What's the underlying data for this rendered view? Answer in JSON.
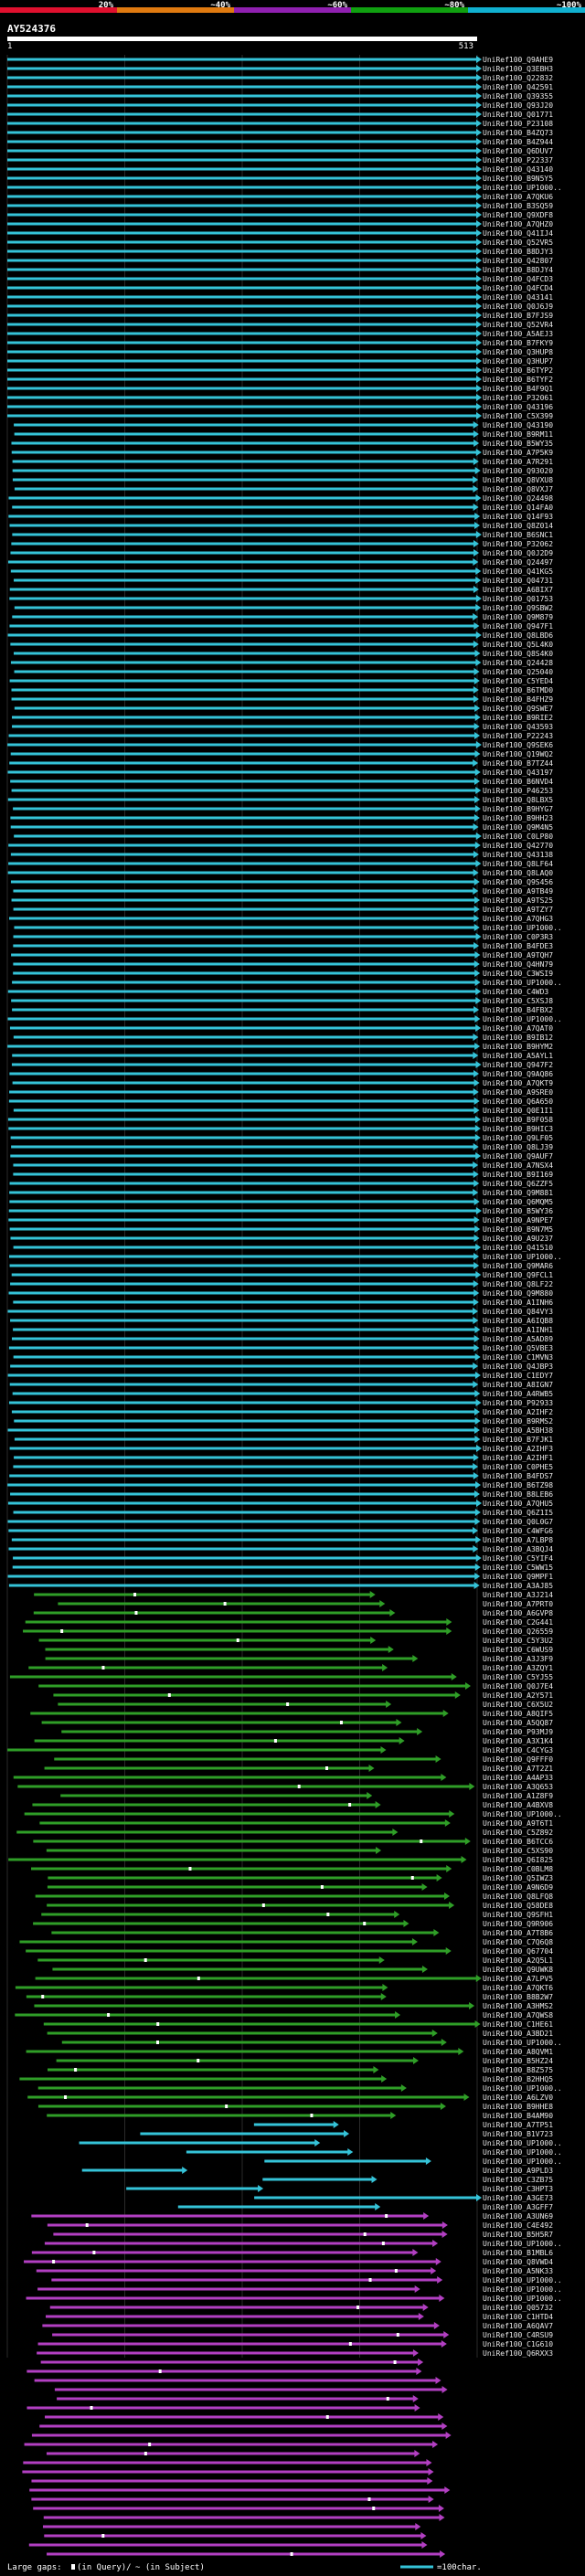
{
  "chart_data": {
    "type": "alignment-overview",
    "title": "AY524376",
    "scale": {
      "ticks": [
        "20%",
        "~40%",
        "~60%",
        "~80%",
        "~100%"
      ],
      "colors": [
        "#e0102e",
        "#e07a10",
        "#9020b0",
        "#10a010",
        "#10b0d0"
      ]
    },
    "query": {
      "start": "1",
      "end": "513"
    },
    "colors": {
      "cyan": "#35c3d8",
      "green": "#2f9e27",
      "magenta": "#b23fc2",
      "gap": "#ffffff",
      "grid": "#2a2a2a",
      "label": "#e8e8e8"
    },
    "legend": {
      "large_gaps": "Large gaps:",
      "in_query": "(in Query)/",
      "in_subject": "~ (in Subject)",
      "scale_note": "=100char."
    },
    "labels": [
      "UniRef100_Q9AHE9",
      "UniRef100_Q3EBH3",
      "UniRef100_Q22832",
      "UniRef100_Q42591",
      "UniRef100_Q39355",
      "UniRef100_Q93J20",
      "UniRef100_Q01771",
      "UniRef100_P23108",
      "UniRef100_B4ZQ73",
      "UniRef100_B4Z944",
      "UniRef100_Q6DUV7",
      "UniRef100_P22337",
      "UniRef100_Q43140",
      "UniRef100_B9N5Y5",
      "UniRef100_UP1000..",
      "UniRef100_A7QKU6",
      "UniRef100_B3SQ59",
      "UniRef100_Q9XDF8",
      "UniRef100_A7QHZ0",
      "UniRef100_Q41IJ4",
      "UniRef100_Q52VR5",
      "UniRef100_B8DJY3",
      "UniRef100_Q42807",
      "UniRef100_B8DJY4",
      "UniRef100_Q4FCD3",
      "UniRef100_Q4FCD4",
      "UniRef100_Q43141",
      "UniRef100_Q0J6J9",
      "UniRef100_B7FJS9",
      "UniRef100_Q52VR4",
      "UniRef100_A5AEJ3",
      "UniRef100_B7FKY9",
      "UniRef100_Q3HUP8",
      "UniRef100_Q3HUP7",
      "UniRef100_B6TYP2",
      "UniRef100_B6TYF2",
      "UniRef100_B4F9Q1",
      "UniRef100_P32061",
      "UniRef100_Q43196",
      "UniRef100_C5X399",
      "UniRef100_Q43190",
      "UniRef100_B9RM11",
      "UniRef100_B5WY35",
      "UniRef100_A7P5K9",
      "UniRef100_A7R291",
      "UniRef100_Q93020",
      "UniRef100_Q8VXU8",
      "UniRef100_Q8VXJ7",
      "UniRef100_Q24498",
      "UniRef100_Q14FA0",
      "UniRef100_Q14F93",
      "UniRef100_Q8Z014",
      "UniRef100_B6SNC1",
      "UniRef100_P32062",
      "UniRef100_Q0J2D9",
      "UniRef100_Q24497",
      "UniRef100_Q41KG5",
      "UniRef100_Q04731",
      "UniRef100_A6BIX7",
      "UniRef100_Q01753",
      "UniRef100_Q9SBW2",
      "UniRef100_Q9M879",
      "UniRef100_Q947F1",
      "UniRef100_Q8LBD6",
      "UniRef100_Q5L4K0",
      "UniRef100_Q8S4K0",
      "UniRef100_Q24428",
      "UniRef100_Q25040",
      "UniRef100_C5YED4",
      "UniRef100_B6TMD0",
      "UniRef100_B4FHZ9",
      "UniRef100_Q9SWE7",
      "UniRef100_B9RIE2",
      "UniRef100_Q43593",
      "UniRef100_P22243",
      "UniRef100_Q9SEK6",
      "UniRef100_Q19WQ2",
      "UniRef100_B7TZ44",
      "UniRef100_Q43197",
      "UniRef100_B6NVD4",
      "UniRef100_P46253",
      "UniRef100_Q8LBX5",
      "UniRef100_B9HYG7",
      "UniRef100_B9HH23",
      "UniRef100_Q9M4N5",
      "UniRef100_C0LP80",
      "UniRef100_Q42770",
      "UniRef100_Q43138",
      "UniRef100_Q8LF64",
      "UniRef100_Q8LAQ0",
      "UniRef100_Q9S456",
      "UniRef100_A9TB49",
      "UniRef100_A9TS25",
      "UniRef100_A9TZY7",
      "UniRef100_A7QHG3",
      "UniRef100_UP1000..",
      "UniRef100_C0P3R3",
      "UniRef100_B4FDE3",
      "UniRef100_A9TQH7",
      "UniRef100_Q4HN79",
      "UniRef100_C3WSI9",
      "UniRef100_UP1000..",
      "UniRef100_C4WD3",
      "UniRef100_C5XSJ8",
      "UniRef100_B4FBX2",
      "UniRef100_UP1000..",
      "UniRef100_A7QAT0",
      "UniRef100_B9IB12",
      "UniRef100_B9HYM2",
      "UniRef100_A5AYL1",
      "UniRef100_Q947F2",
      "UniRef100_Q9AQ86",
      "UniRef100_A7QKT9",
      "UniRef100_A9SRE0",
      "UniRef100_Q6A650",
      "UniRef100_Q0E1I1",
      "UniRef100_B9F058",
      "UniRef100_B9HIC3",
      "UniRef100_Q9LF05",
      "UniRef100_Q8LJ39",
      "UniRef100_Q9AUF7",
      "UniRef100_A7NSX4",
      "UniRef100_B9I169",
      "UniRef100_Q6ZZF5",
      "UniRef100_Q9M881",
      "UniRef100_Q6MQM5",
      "UniRef100_B5WY36",
      "UniRef100_A9NPE7",
      "UniRef100_B9N7M5",
      "UniRef100_A9U237",
      "UniRef100_Q41510",
      "UniRef100_UP1000..",
      "UniRef100_Q9MAR6",
      "UniRef100_Q9FCL1",
      "UniRef100_Q8LF22",
      "UniRef100_Q9M880",
      "UniRef100_A1INH6",
      "UniRef100_Q84VY3",
      "UniRef100_A6IQB8",
      "UniRef100_A1INH1",
      "UniRef100_A5AD89",
      "UniRef100_Q5VBE3",
      "UniRef100_C1MVN3",
      "UniRef100_Q4JBP3",
      "UniRef100_C1EDY7",
      "UniRef100_A8IGN7",
      "UniRef100_A4RWB5",
      "UniRef100_P92933",
      "UniRef100_A2IHF2",
      "UniRef100_B9RMS2",
      "UniRef100_A5BH38",
      "UniRef100_B7FJK1",
      "UniRef100_A2IHF3",
      "UniRef100_A2IHF1",
      "UniRef100_C0PHE5",
      "UniRef100_B4FDS7",
      "UniRef100_B6TZ98",
      "UniRef100_B8LEB6",
      "UniRef100_A7QHU5",
      "UniRef100_Q6Z1I5",
      "UniRef100_Q0L0G7",
      "UniRef100_C4WFG6",
      "UniRef100_A7LBP8",
      "UniRef100_A3BQJ4",
      "UniRef100_C5YIF4",
      "UniRef100_C5WW15",
      "UniRef100_Q9MPF1",
      "UniRef100_A3AJ85",
      "UniRef100_A3J214",
      "UniRef100_A7PRT0",
      "UniRef100_A6GVP8",
      "UniRef100_C2G441",
      "UniRef100_Q26559",
      "UniRef100_C5Y3U2",
      "UniRef100_C6WUS9",
      "UniRef100_A3J3F9",
      "UniRef100_A3ZQY1",
      "UniRef100_C5YJ55",
      "UniRef100_Q0J7E4",
      "UniRef100_A2Y571",
      "UniRef100_C6X5U2",
      "UniRef100_A8QIF5",
      "UniRef100_A5QQ87",
      "UniRef100_P93MJ9",
      "UniRef100_A3X1K4",
      "UniRef100_C4CYG3",
      "UniRef100_Q9FFF0",
      "UniRef100_A7T2Z1",
      "UniRef100_A4AP33",
      "UniRef100_A3Q653",
      "UniRef100_A1Z8F9",
      "UniRef100_A4BXV8",
      "UniRef100_UP1000..",
      "UniRef100_A9T6T1",
      "UniRef100_C5Z892",
      "UniRef100_B6TCC6",
      "UniRef100_C5XS90",
      "UniRef100_Q6I825",
      "UniRef100_C0BLM8",
      "UniRef100_Q5IWZ3",
      "UniRef100_A9N6D9",
      "UniRef100_Q8LFQ8",
      "UniRef100_Q58DE8",
      "UniRef100_Q9SFH1",
      "UniRef100_Q9R906",
      "UniRef100_A7T8B6",
      "UniRef100_C7Q6Q8",
      "UniRef100_Q67704",
      "UniRef100_A2Q5L1",
      "UniRef100_Q9UWK8",
      "UniRef100_A7LPV5",
      "UniRef100_A7QKT6",
      "UniRef100_B8B2W7",
      "UniRef100_A3HMS2",
      "UniRef100_A7QWS8",
      "UniRef100_C1HE61",
      "UniRef100_A3BD21",
      "UniRef100_UP1000..",
      "UniRef100_A8QVM1",
      "UniRef100_B5HZ24",
      "UniRef100_B8Z575",
      "UniRef100_B2HHQ5",
      "UniRef100_UP1000..",
      "UniRef100_A6LZV0",
      "UniRef100_B9HHE8",
      "UniRef100_B4AM90",
      "UniRef100_A7TP51",
      "UniRef100_B1V723",
      "UniRef100_UP1000..",
      "UniRef100_UP1000..",
      "UniRef100_UP1000..",
      "UniRef100_A9PLD3",
      "UniRef100_C3ZB75",
      "UniRef100_C3HPT3",
      "UniRef100_A3GE73",
      "UniRef100_A3GFF7",
      "UniRef100_A3UN69",
      "UniRef100_C4E492",
      "UniRef100_B5H5R7",
      "UniRef100_UP1000..",
      "UniRef100_B1MBL6",
      "UniRef100_Q8VWD4",
      "UniRef100_A5NK33",
      "UniRef100_UP1000..",
      "UniRef100_UP1000..",
      "UniRef100_UP1000..",
      "UniRef100_Q05732",
      "UniRef100_C1HTD4",
      "UniRef100_A6QAV7",
      "UniRef100_C4RSU9",
      "UniRef100_C1G610",
      "UniRef100_Q6RXX3"
    ],
    "segments": [
      {
        "group": "cyan",
        "count": 168
      },
      {
        "group": "green",
        "count": 58
      },
      {
        "group": "cyan",
        "count": 10
      },
      {
        "group": "magenta",
        "count": 38
      }
    ]
  }
}
